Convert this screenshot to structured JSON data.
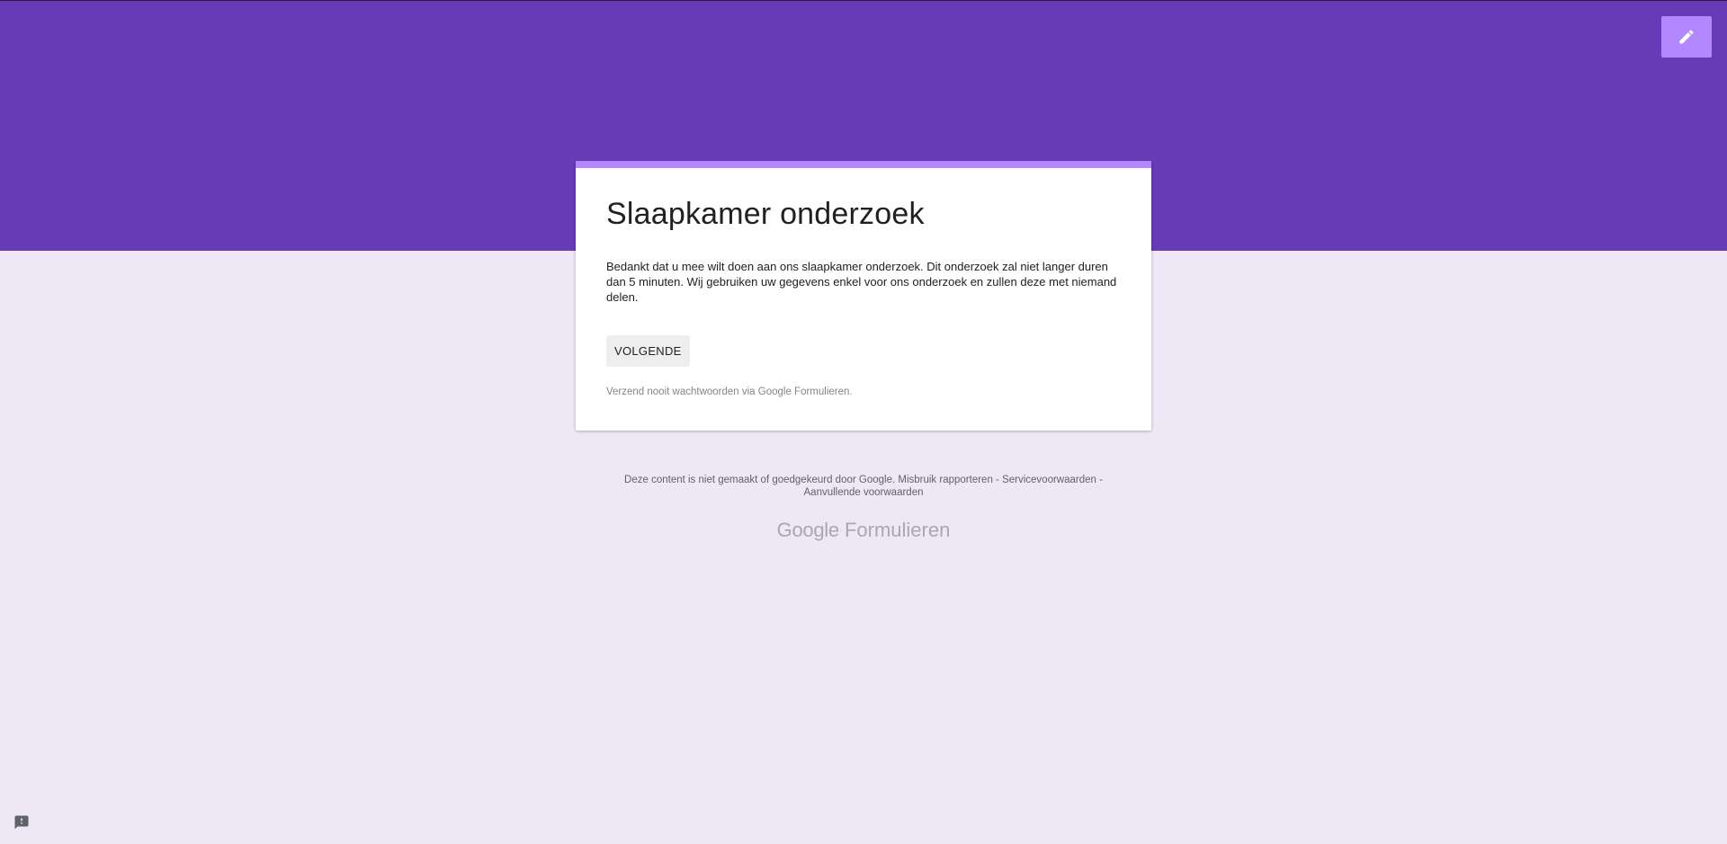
{
  "form": {
    "title": "Slaapkamer onderzoek",
    "description": "Bedankt dat u mee wilt doen aan ons slaapkamer onderzoek. Dit onderzoek zal niet langer duren dan 5 minuten. Wij gebruiken uw gegevens enkel voor ons onderzoek en zullen deze met niemand delen.",
    "next_label": "VOLGENDE",
    "password_warning": "Verzend nooit wachtwoorden via Google Formulieren."
  },
  "footer": {
    "disclaimer": "Deze content is niet gemaakt of goedgekeurd door Google.",
    "report_abuse": "Misbruik rapporteren",
    "sep1": " - ",
    "terms": "Servicevoorwaarden",
    "sep2": " - ",
    "additional_terms": "Aanvullende voorwaarden"
  },
  "brand": {
    "google": "Google",
    "product": "Formulieren"
  },
  "icons": {
    "edit": "pencil-icon",
    "feedback": "feedback-icon"
  },
  "colors": {
    "header": "#673ab7",
    "accent": "#b388ff",
    "background": "#ede7f6"
  }
}
